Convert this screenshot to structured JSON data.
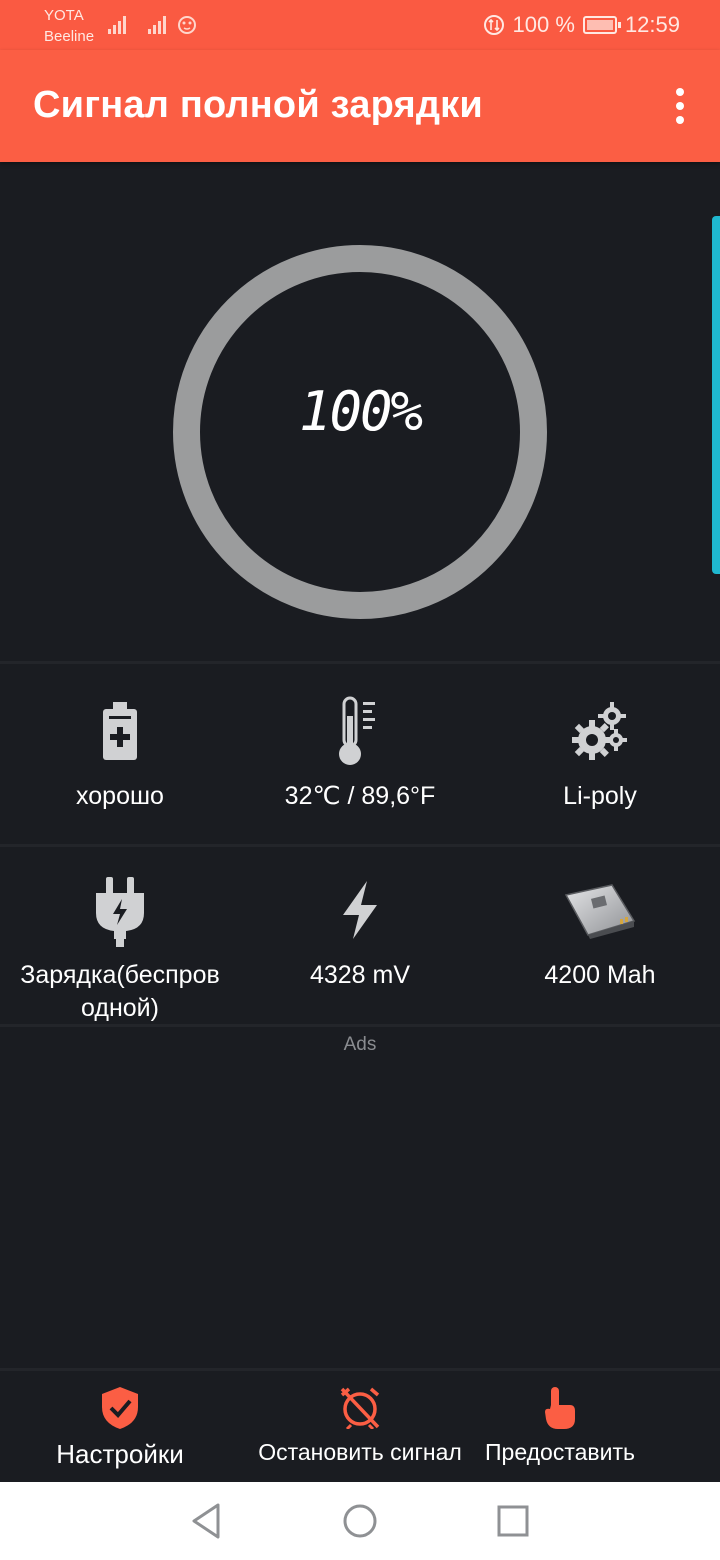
{
  "status_bar": {
    "carrier_1": "YOTA",
    "carrier_2": "Beeline",
    "battery_percent": "100 %",
    "time": "12:59"
  },
  "toolbar": {
    "title": "Сигнал полной зарядки",
    "menu_icon": "more-vert-icon"
  },
  "gauge": {
    "value": "100%",
    "level_fraction": 1.0
  },
  "info": {
    "health": {
      "icon": "battery-plus-icon",
      "label": "хорошо"
    },
    "temperature": {
      "icon": "thermometer-icon",
      "label": "32℃ / 89,6°F"
    },
    "technology": {
      "icon": "gears-icon",
      "label": "Li-poly"
    },
    "charging": {
      "icon": "plug-icon",
      "label": "Зарядка(беспров одной)"
    },
    "voltage": {
      "icon": "lightning-icon",
      "label": "4328 mV"
    },
    "capacity": {
      "icon": "battery-pack-icon",
      "label": "4200 Mah"
    }
  },
  "ads_label": "Ads",
  "bottom_nav": {
    "settings": "Настройки",
    "stop_alarm": "Остановить сигнал",
    "provide": "Предоставить"
  },
  "colors": {
    "accent": "#fb5e44",
    "background": "#1a1c21",
    "ring": "#9b9c9d",
    "scroll_accent": "#1fb7cf"
  }
}
